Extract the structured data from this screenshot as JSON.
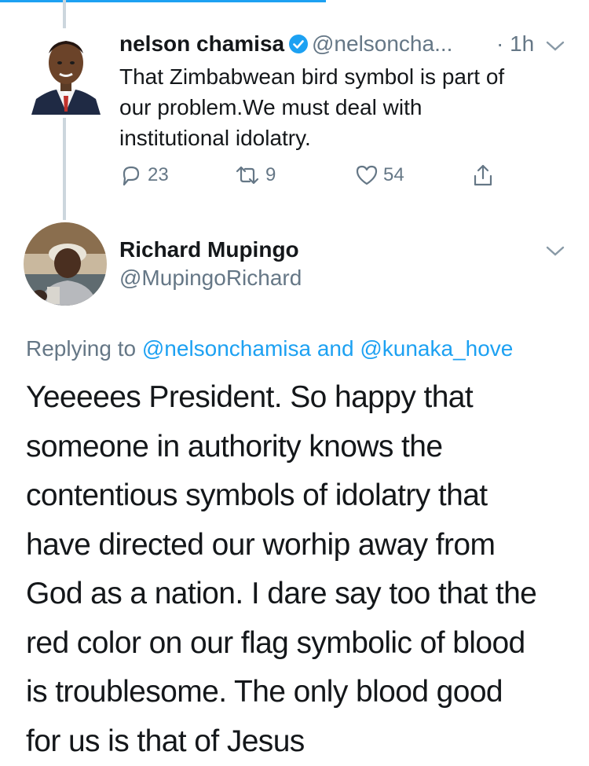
{
  "tweet": {
    "author_name": "nelson chamisa",
    "author_handle": "@nelsoncha...",
    "time": "· 1h",
    "text": [
      "That Zimbabwean bird symbol is part of",
      "our problem.We must deal with",
      "institutional idolatry."
    ],
    "replies_count": "23",
    "retweets_count": "9",
    "likes_count": "54"
  },
  "reply": {
    "author_name": "Richard Mupingo",
    "author_handle": "@MupingoRichard",
    "replying_prefix": "Replying to",
    "replying_user1": "@nelsonchamisa",
    "replying_and": "and",
    "replying_user2": "@kunaka_hove",
    "text_lines": [
      "Yeeeees President. So happy that",
      "someone in authority knows the",
      "contentious symbols of idolatry that",
      "have directed our worhip away from",
      "God as a nation. I dare say too that the",
      "red color on our flag symbolic of blood",
      "is troublesome. The only blood good",
      "for us is  that of Jesus"
    ]
  },
  "colors": {
    "accent": "#1da1f2",
    "muted": "#657786",
    "text": "#14171a",
    "thread_line": "#ccd6dd"
  },
  "icons": [
    "verified-badge-icon",
    "chevron-down-icon",
    "reply-icon",
    "retweet-icon",
    "like-icon",
    "share-icon"
  ]
}
